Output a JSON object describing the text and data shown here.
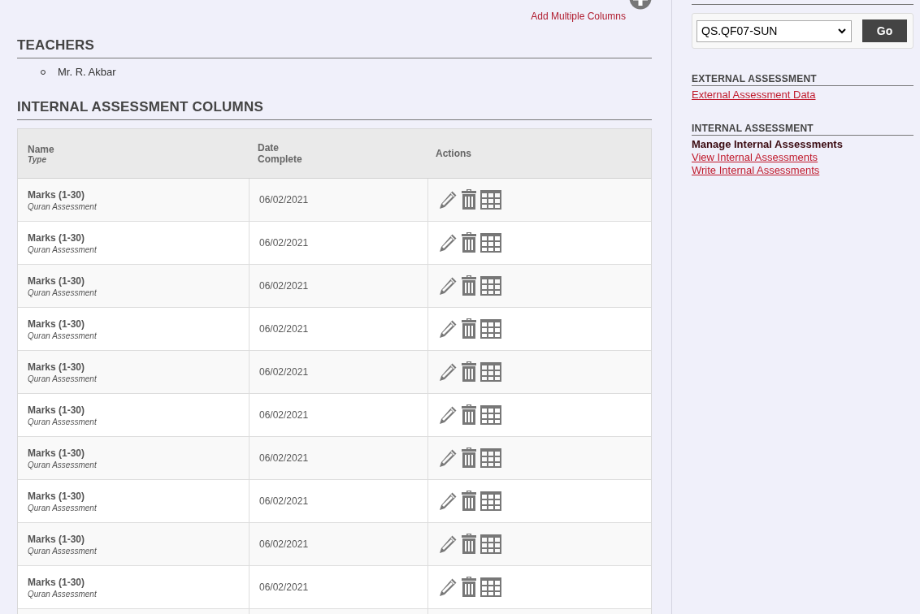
{
  "add_link": {
    "label": "Add Multiple Columns"
  },
  "teachers": {
    "heading": "TEACHERS",
    "items": [
      "Mr. R. Akbar"
    ]
  },
  "assessment_columns": {
    "heading": "INTERNAL ASSESSMENT COLUMNS",
    "table": {
      "columns": [
        {
          "label": "Name",
          "sublabel": "Type"
        },
        {
          "label": "Date Complete"
        },
        {
          "label": "Actions"
        }
      ],
      "rows": [
        {
          "name": "Marks (1-30)",
          "type": "Quran Assessment",
          "date": "06/02/2021"
        },
        {
          "name": "Marks (1-30)",
          "type": "Quran Assessment",
          "date": "06/02/2021"
        },
        {
          "name": "Marks (1-30)",
          "type": "Quran Assessment",
          "date": "06/02/2021"
        },
        {
          "name": "Marks (1-30)",
          "type": "Quran Assessment",
          "date": "06/02/2021"
        },
        {
          "name": "Marks (1-30)",
          "type": "Quran Assessment",
          "date": "06/02/2021"
        },
        {
          "name": "Marks (1-30)",
          "type": "Quran Assessment",
          "date": "06/02/2021"
        },
        {
          "name": "Marks (1-30)",
          "type": "Quran Assessment",
          "date": "06/02/2021"
        },
        {
          "name": "Marks (1-30)",
          "type": "Quran Assessment",
          "date": "06/02/2021"
        },
        {
          "name": "Marks (1-30)",
          "type": "Quran Assessment",
          "date": "06/02/2021"
        },
        {
          "name": "Marks (1-30)",
          "type": "Quran Assessment",
          "date": "06/02/2021"
        }
      ]
    }
  },
  "sidebar": {
    "class_select": {
      "value": "QS.QF07-SUN"
    },
    "go_button": {
      "label": "Go"
    },
    "sections": [
      {
        "heading": "EXTERNAL ASSESSMENT",
        "links": [
          {
            "label": "External Assessment Data",
            "selected": false
          }
        ]
      },
      {
        "heading": "INTERNAL ASSESSMENT",
        "links": [
          {
            "label": "Manage Internal Assessments",
            "selected": true
          },
          {
            "label": "View Internal Assessments",
            "selected": false
          },
          {
            "label": "Write Internal Assessments",
            "selected": false
          }
        ]
      }
    ]
  }
}
